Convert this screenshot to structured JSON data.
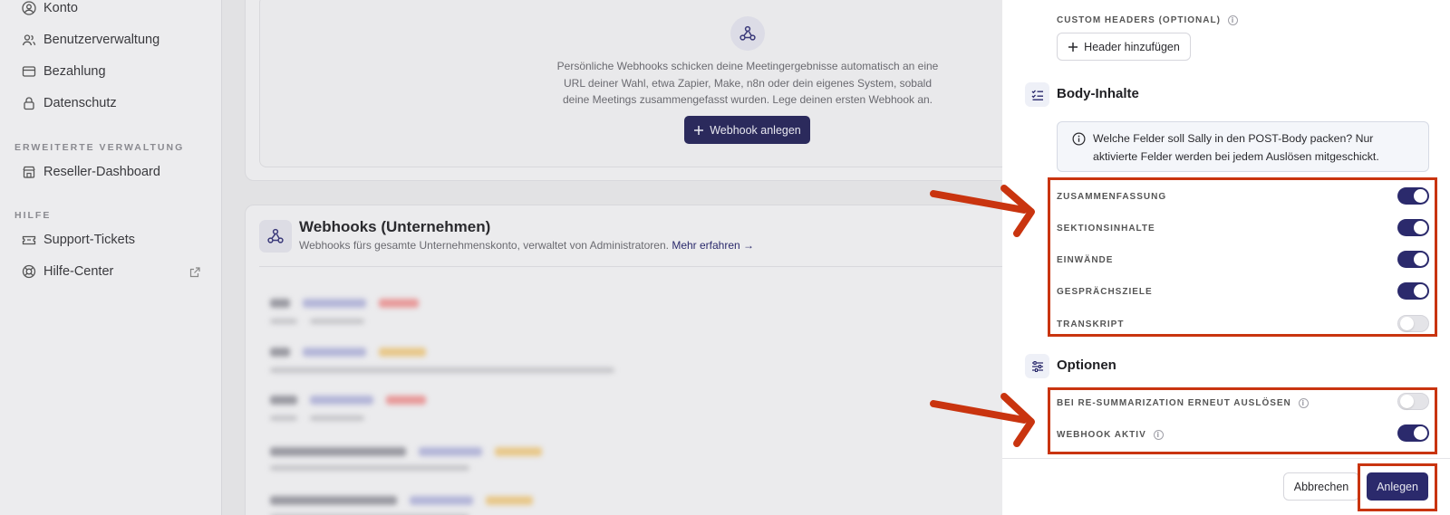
{
  "sidebar": {
    "items": [
      {
        "label": "Konto",
        "icon": "user-circle-icon"
      },
      {
        "label": "Benutzerverwaltung",
        "icon": "users-icon"
      },
      {
        "label": "Bezahlung",
        "icon": "credit-card-icon"
      },
      {
        "label": "Datenschutz",
        "icon": "lock-icon"
      }
    ],
    "section_advanced": "ERWEITERTE VERWALTUNG",
    "reseller": {
      "label": "Reseller-Dashboard",
      "icon": "store-icon"
    },
    "section_help": "HILFE",
    "support": {
      "label": "Support-Tickets",
      "icon": "ticket-icon"
    },
    "help_center": {
      "label": "Hilfe-Center",
      "icon": "lifebuoy-icon",
      "external_icon": "external-link-icon"
    }
  },
  "personal_webhooks": {
    "empty_text": "Persönliche Webhooks schicken deine Meetingergebnisse automatisch an eine URL deiner Wahl, etwa Zapier, Make, n8n oder dein eigenes System, sobald deine Meetings zusammengefasst wurden. Lege deinen ersten Webhook an.",
    "create_button": "Webhook anlegen"
  },
  "company_webhooks": {
    "title": "Webhooks (Unternehmen)",
    "subtitle": "Webhooks fürs gesamte Unternehmenskonto, verwaltet von Administratoren.",
    "learn_more": "Mehr erfahren →"
  },
  "drawer": {
    "custom_headers_label": "CUSTOM HEADERS (OPTIONAL)",
    "add_header_button": "Header hinzufügen",
    "body_section_title": "Body-Inhalte",
    "body_info": "Welche Felder soll Sally in den POST-Body packen? Nur aktivierte Felder werden bei jedem Auslösen mitgeschickt.",
    "body_fields": [
      {
        "label": "ZUSAMMENFASSUNG",
        "on": true
      },
      {
        "label": "SEKTIONSINHALTE",
        "on": true
      },
      {
        "label": "EINWÄNDE",
        "on": true
      },
      {
        "label": "GESPRÄCHSZIELE",
        "on": true
      },
      {
        "label": "TRANSKRIPT",
        "on": false
      }
    ],
    "options_title": "Optionen",
    "options": [
      {
        "label": "BEI RE-SUMMARIZATION ERNEUT AUSLÖSEN",
        "on": false
      },
      {
        "label": "WEBHOOK AKTIV",
        "on": true
      }
    ],
    "cancel_button": "Abbrechen",
    "submit_button": "Anlegen"
  },
  "colors": {
    "primary": "#2b2a6c",
    "annotation": "#c9340f"
  }
}
